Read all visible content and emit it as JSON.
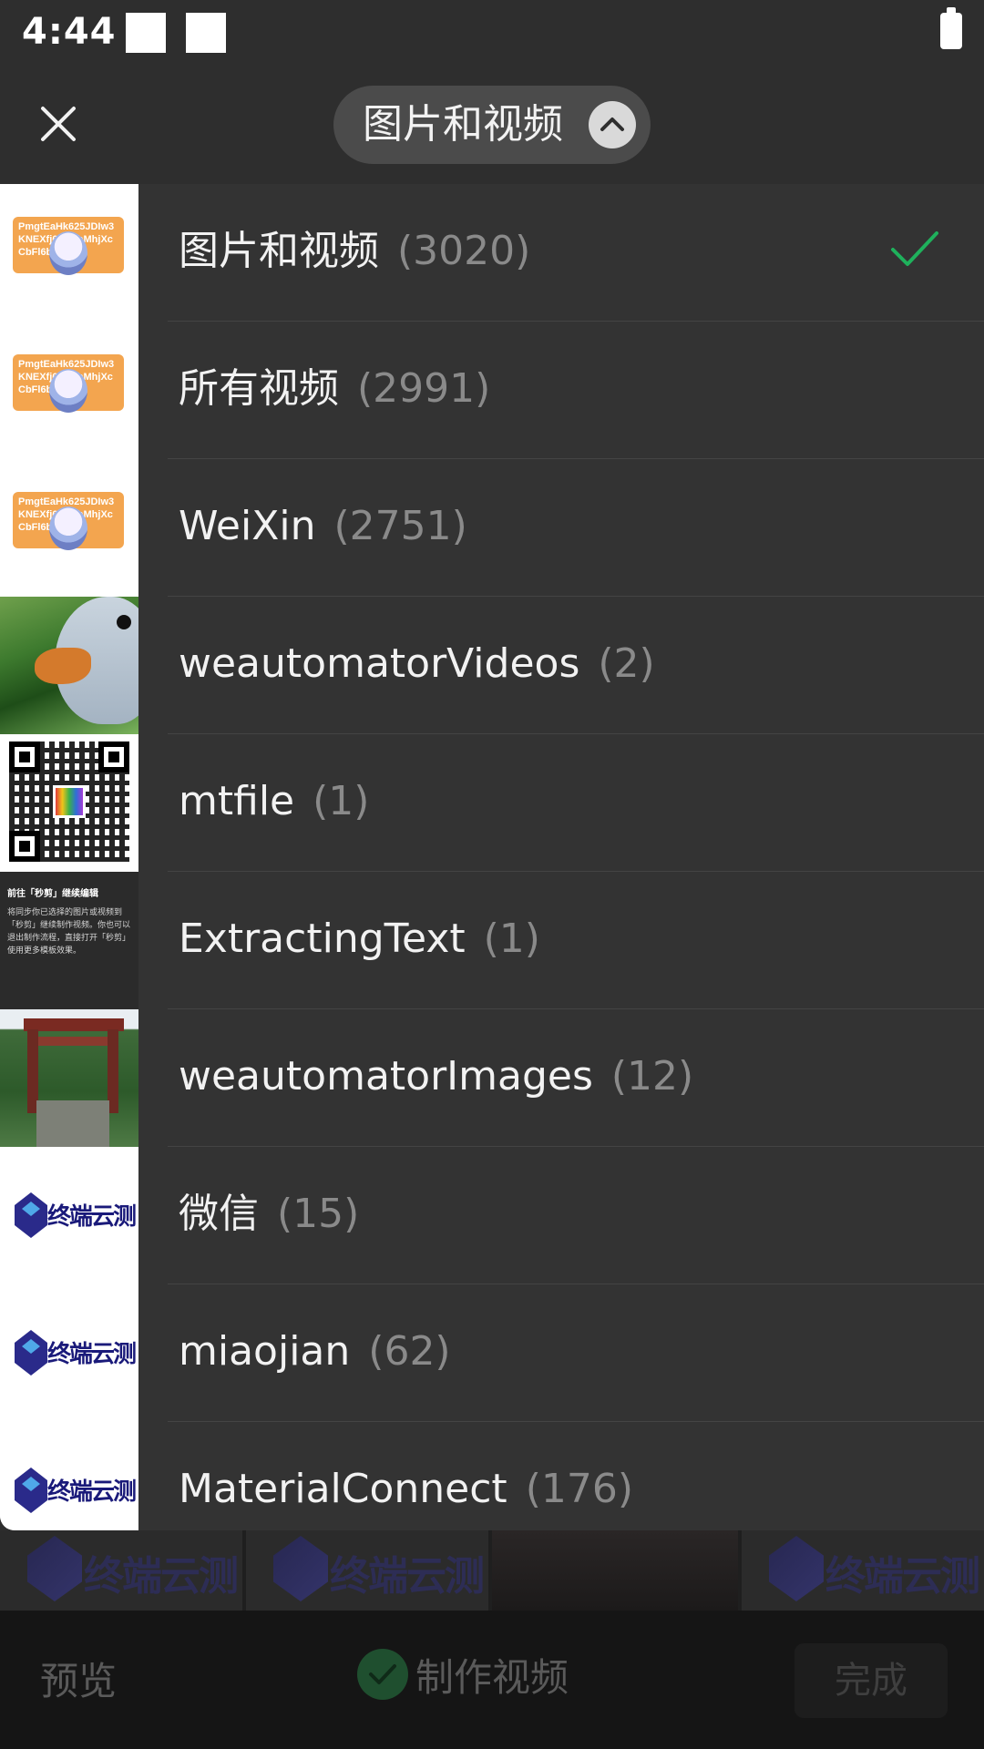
{
  "status_bar": {
    "time": "4:44"
  },
  "header": {
    "title": "图片和视频"
  },
  "albums": [
    {
      "name": "图片和视频",
      "count": "(3020)",
      "selected": true
    },
    {
      "name": "所有视频",
      "count": "(2991)",
      "selected": false
    },
    {
      "name": "WeiXin",
      "count": "(2751)",
      "selected": false
    },
    {
      "name": "weautomatorVideos",
      "count": "(2)",
      "selected": false
    },
    {
      "name": "mtfile",
      "count": "(1)",
      "selected": false
    },
    {
      "name": "ExtractingText",
      "count": "(1)",
      "selected": false
    },
    {
      "name": "weautomatorImages",
      "count": "(12)",
      "selected": false
    },
    {
      "name": "微信",
      "count": "(15)",
      "selected": false
    },
    {
      "name": "miaojian",
      "count": "(62)",
      "selected": false
    },
    {
      "name": "MaterialConnect",
      "count": "(176)",
      "selected": false
    }
  ],
  "thumbnails": {
    "badge_text": "PmgtEaHk625JDIw3KNEXfj6BuphMhjXcCbFl6b3eQ",
    "text_card_title": "前往「秒剪」继续编辑",
    "text_card_body": "将同步你已选择的图片或视频到「秒剪」继续制作视频。你也可以退出制作流程，直接打开「秒剪」使用更多模板效果。",
    "logo_text": "终端云测"
  },
  "bottom_bar": {
    "preview": "预览",
    "make_video": "制作视频",
    "done": "完成"
  },
  "colors": {
    "accent_check": "#1fb15c",
    "background": "#2e2e2e",
    "list_background": "#333333"
  }
}
